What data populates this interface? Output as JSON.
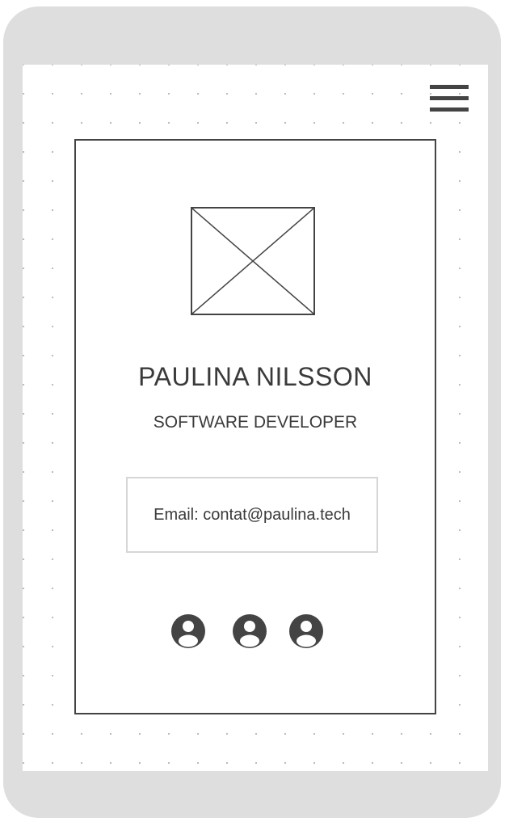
{
  "header": {
    "menu_icon": "hamburger-menu-icon"
  },
  "profile": {
    "image_icon": "image-placeholder-icon",
    "name": "PAULINA NILSSON",
    "title": "SOFTWARE DEVELOPER",
    "email_text": "Email: contat@paulina.tech"
  },
  "social_links": [
    {
      "icon": "user-circle-icon"
    },
    {
      "icon": "user-circle-icon"
    },
    {
      "icon": "user-circle-icon"
    }
  ],
  "colors": {
    "device_frame": "#dedede",
    "ink": "#444444",
    "text": "#3a3a3a",
    "email_border": "#d6d6d6",
    "dot_grid": "#b8b8b8"
  }
}
